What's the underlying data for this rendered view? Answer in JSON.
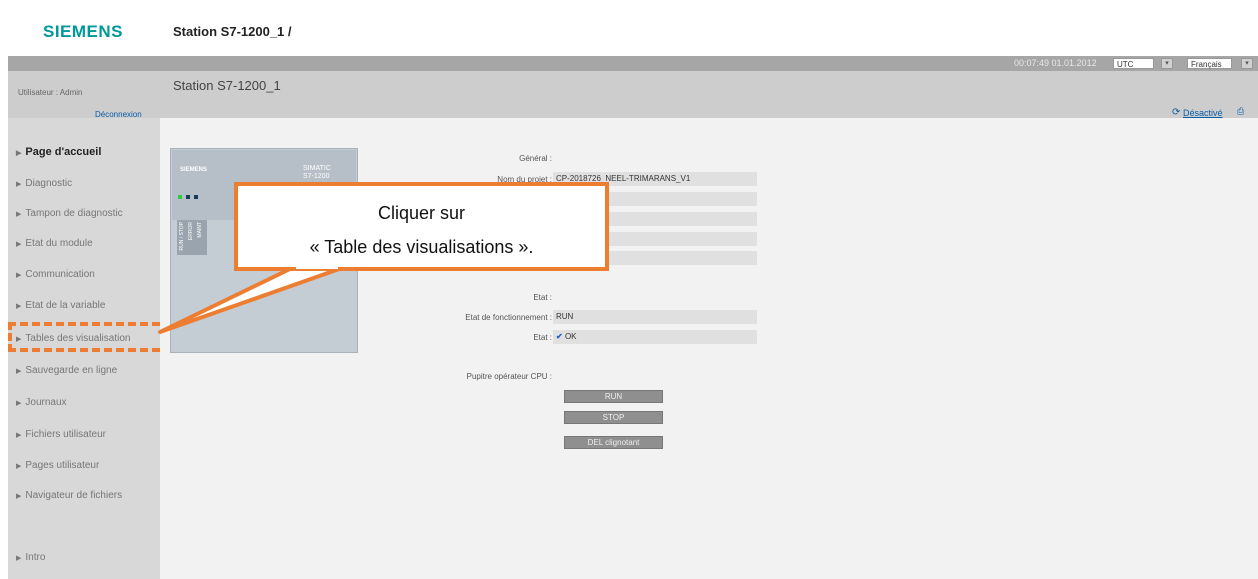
{
  "header": {
    "brand": "SIEMENS",
    "breadcrumb": "Station S7-1200_1 /"
  },
  "statusbar": {
    "clock": "00:07:49  01.01.2012",
    "timezone": "UTC",
    "language": "Français"
  },
  "user": {
    "label": "Utilisateur : Admin",
    "logout": "Déconnexion"
  },
  "page": {
    "title": "Station S7-1200_1",
    "deactivate": "Désactivé"
  },
  "sidebar": {
    "items": [
      {
        "label": "Page d'accueil",
        "active": true
      },
      {
        "label": "Diagnostic"
      },
      {
        "label": "Tampon de diagnostic"
      },
      {
        "label": "Etat du module"
      },
      {
        "label": "Communication"
      },
      {
        "label": "Etat de la variable"
      },
      {
        "label": "Tables des visualisation"
      },
      {
        "label": "Sauvegarde en ligne"
      },
      {
        "label": "Journaux"
      },
      {
        "label": "Fichiers utilisateur"
      },
      {
        "label": "Pages utilisateur"
      },
      {
        "label": "Navigateur de fichiers"
      },
      {
        "label": "Intro"
      }
    ]
  },
  "plc_image": {
    "brand": "SIEMENS",
    "model_line1": "SIMATIC",
    "model_line2": "S7-1200",
    "led_labels": [
      "RUN / STOP",
      "ERROR",
      "MAINT"
    ]
  },
  "general": {
    "heading": "Général :",
    "project_label": "Nom du projet :",
    "project_value": "CP-2018726_NEEL-TRIMARANS_V1",
    "row2_value": "",
    "station_value": "200_1",
    "row4_value": "ans",
    "type_value": "DC/DC/Rly"
  },
  "etat": {
    "heading": "Etat :",
    "op_state_label": "Etat de fonctionnement :",
    "op_state_value": "RUN",
    "state_label": "Etat :",
    "state_value": "OK",
    "state_icon": "check-icon",
    "check_color": "#1a5fc4"
  },
  "cpu_panel": {
    "heading": "Pupitre opérateur CPU :",
    "buttons": [
      "RUN",
      "STOP",
      "DEL clignotant"
    ]
  },
  "callout": {
    "line1": "Cliquer sur",
    "line2": "« Table des visualisations ».",
    "accent": "#ed7d31"
  }
}
